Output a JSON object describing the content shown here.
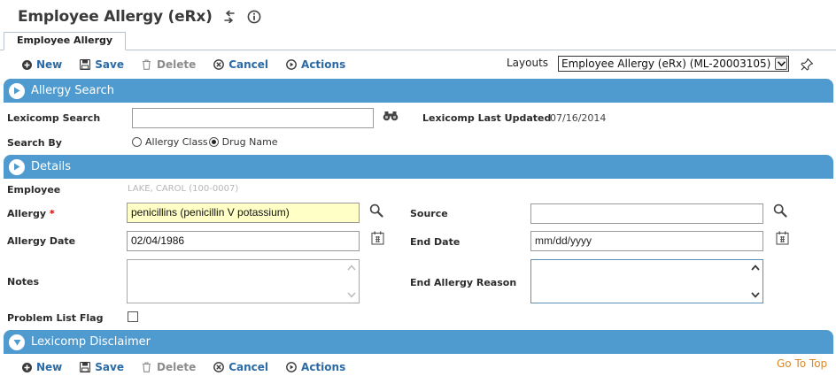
{
  "page": {
    "title": "Employee Allergy (eRx)"
  },
  "tabs": [
    {
      "label": "Employee Allergy"
    }
  ],
  "toolbar": {
    "new_label": "New",
    "save_label": "Save",
    "delete_label": "Delete",
    "cancel_label": "Cancel",
    "actions_label": "Actions"
  },
  "layouts": {
    "label": "Layouts",
    "selected": "Employee Allergy (eRx) (ML-20003105)"
  },
  "allergy_search": {
    "header": "Allergy Search",
    "lexicomp_search_label": "Lexicomp Search",
    "lexicomp_search_value": "",
    "last_updated_label": "Lexicomp Last Updated",
    "last_updated_value": "07/16/2014",
    "search_by_label": "Search By",
    "options": [
      "Allergy Class",
      "Drug Name"
    ],
    "selected_option": "Drug Name"
  },
  "details": {
    "header": "Details",
    "employee_label": "Employee",
    "employee_value": "LAKE, CAROL (100-0007)",
    "allergy_label": "Allergy",
    "allergy_required": "*",
    "allergy_value": "penicillins (penicillin V potassium)",
    "source_label": "Source",
    "source_value": "",
    "allergy_date_label": "Allergy Date",
    "allergy_date_value": "02/04/1986",
    "end_date_label": "End Date",
    "end_date_value": "mm/dd/yyyy",
    "notes_label": "Notes",
    "end_reason_label": "End Allergy Reason",
    "problem_list_label": "Problem List Flag"
  },
  "disclaimer": {
    "header": "Lexicomp Disclaimer"
  },
  "footer": {
    "go_to_top": "Go To Top"
  },
  "colors": {
    "section_bar": "#4f9bd0",
    "link_blue": "#2a6aa6",
    "required_yellow": "#ffffc6",
    "go_top_orange": "#d98a2b"
  }
}
